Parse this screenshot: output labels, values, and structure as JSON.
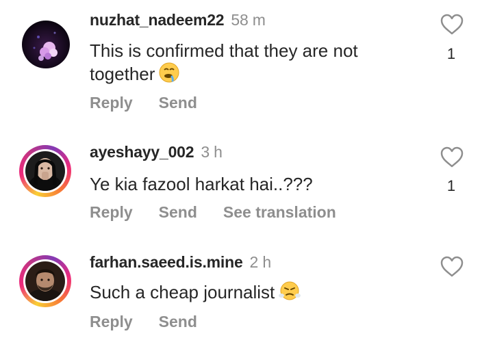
{
  "comments": [
    {
      "username": "nuzhat_nadeem22",
      "time": "58 m",
      "text": "This is confirmed that they are not together",
      "emoji_icon": "drooling-face-emoji",
      "likes": "1",
      "actions": [
        "Reply",
        "Send"
      ]
    },
    {
      "username": "ayeshayy_002",
      "time": "3 h",
      "text": "Ye kia fazool harkat hai..???",
      "likes": "1",
      "actions": [
        "Reply",
        "Send",
        "See translation"
      ]
    },
    {
      "username": "farhan.saeed.is.mine",
      "time": "2 h",
      "text": "Such a cheap journalist",
      "emoji_icon": "face-with-steam-emoji",
      "actions": [
        "Reply",
        "Send"
      ]
    }
  ],
  "colors": {
    "text": "#262626",
    "secondary": "#8e8e8e",
    "story_ring_start": "#f9ce34",
    "story_ring_mid": "#ee2a7b",
    "story_ring_end": "#833ab4"
  },
  "icons": {
    "like": "heart-outline-icon"
  }
}
